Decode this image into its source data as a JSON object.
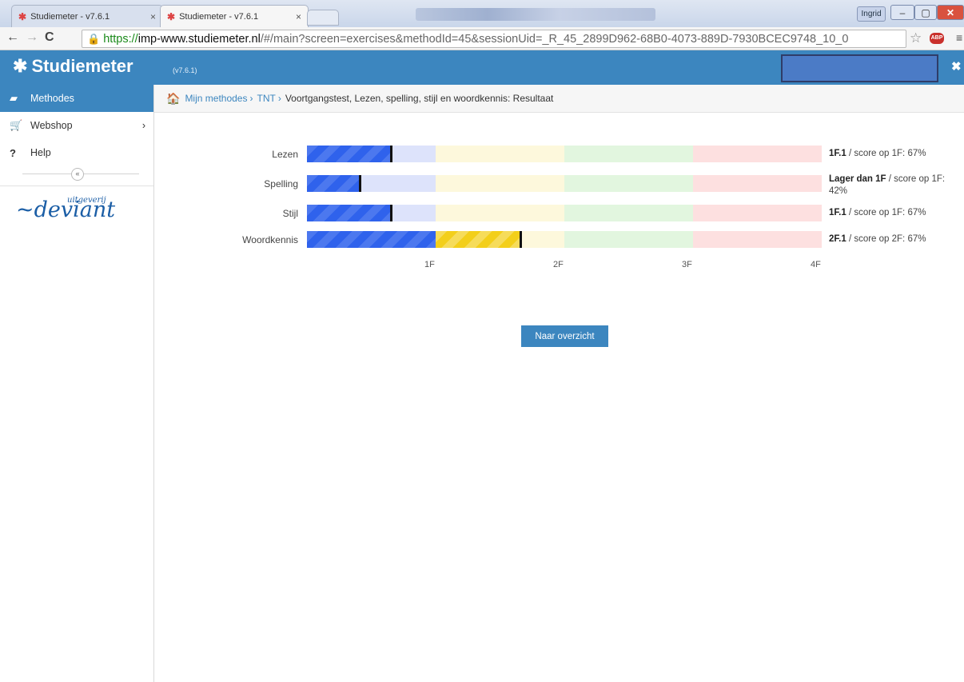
{
  "browser": {
    "tabs": [
      {
        "title": "Studiemeter - v7.6.1",
        "active": false
      },
      {
        "title": "Studiemeter - v7.6.1",
        "active": true
      }
    ],
    "user_badge": "Ingrid",
    "url": {
      "scheme": "https://",
      "host": "imp-www.studiemeter.nl",
      "path": "/#/main?screen=exercises&methodId=45&sessionUid=_R_45_2899D962-68B0-4073-889D-7930BCEC9748_10_0"
    },
    "abp_label": "ABP"
  },
  "app": {
    "brand": "Studiemeter",
    "version": "(v7.6.1)"
  },
  "sidebar": {
    "items": [
      {
        "label": "Methodes",
        "icon": "book-icon",
        "active": true
      },
      {
        "label": "Webshop",
        "icon": "cart-icon",
        "active": false
      },
      {
        "label": "Help",
        "icon": "question-icon",
        "active": false
      }
    ],
    "logo": {
      "small": "uitgeverij",
      "big": "~deviant"
    }
  },
  "breadcrumb": {
    "items": [
      "Mijn methodes",
      "TNT"
    ],
    "current": "Voortgangstest, Lezen, spelling, stijl en woordkennis: Resultaat"
  },
  "chart_data": {
    "type": "bar",
    "levels": [
      "1F",
      "2F",
      "3F",
      "4F"
    ],
    "xlim": [
      0,
      4
    ],
    "categories": [
      "Lezen",
      "Spelling",
      "Stijl",
      "Woordkennis"
    ],
    "values": [
      0.65,
      0.41,
      0.65,
      1.66
    ],
    "results": [
      {
        "level": "1F.1",
        "rest": " / score op 1F: 67%"
      },
      {
        "level": "Lager dan 1F",
        "rest": " / score op 1F: 42%"
      },
      {
        "level": "1F.1",
        "rest": " / score op 1F: 67%"
      },
      {
        "level": "2F.1",
        "rest": " / score op 2F: 67%"
      }
    ],
    "zone_colors": [
      "#dde3fb",
      "#fdf8dc",
      "#e2f6df",
      "#fde0e0"
    ],
    "fill_colors": [
      "#2f62ec",
      "#f3cf1a"
    ]
  },
  "buttons": {
    "overview": "Naar overzicht"
  }
}
